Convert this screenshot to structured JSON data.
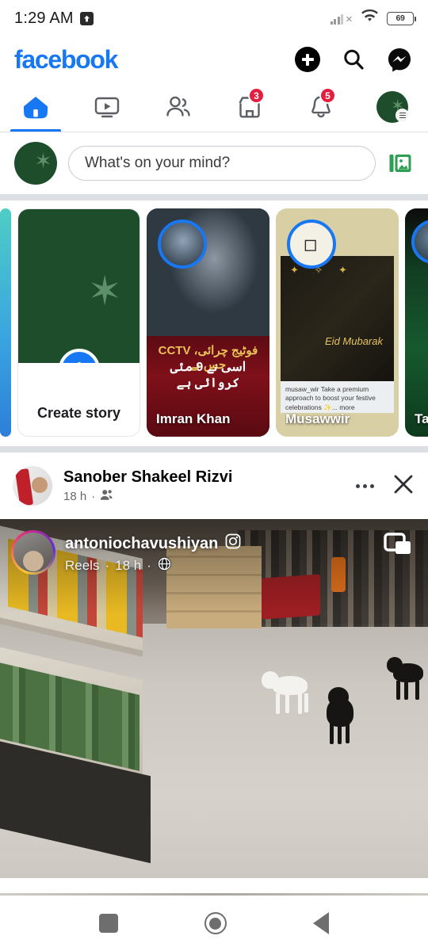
{
  "status_bar": {
    "time": "1:29 AM",
    "upload_icon": "upload-arrow-icon",
    "signal_icon": "cellular-signal-off-icon",
    "wifi_icon": "wifi-icon",
    "battery_level": "69"
  },
  "header": {
    "logo_text": "facebook",
    "logo_color": "#1877F2",
    "actions": [
      {
        "name": "create-button",
        "icon": "plus-circle-icon"
      },
      {
        "name": "search-button",
        "icon": "search-icon"
      },
      {
        "name": "messenger-button",
        "icon": "messenger-icon"
      }
    ]
  },
  "tabs": [
    {
      "name": "tab-home",
      "icon": "home-icon",
      "active": true,
      "badge": ""
    },
    {
      "name": "tab-video",
      "icon": "video-icon",
      "active": false,
      "badge": ""
    },
    {
      "name": "tab-friends",
      "icon": "friends-icon",
      "active": false,
      "badge": ""
    },
    {
      "name": "tab-marketplace",
      "icon": "marketplace-icon",
      "active": false,
      "badge": "3"
    },
    {
      "name": "tab-notifications",
      "icon": "bell-icon",
      "active": false,
      "badge": "5"
    },
    {
      "name": "tab-menu",
      "icon": "profile-menu-icon",
      "active": false,
      "badge": ""
    }
  ],
  "composer": {
    "placeholder": "What's on your mind?",
    "avatar_icon": "user-avatar",
    "photo_icon": "photo-gallery-icon",
    "photo_color": "#2e9e52"
  },
  "stories": {
    "create": {
      "label": "Create story",
      "plus_icon": "plus-icon",
      "bg_color": "#1d4d2b"
    },
    "items": [
      {
        "name": "Imran Khan",
        "caption_line1": "CCTV فوٹیج چرائی، جس نے",
        "caption_line2": "اسی نے 9 مئی کروائی ہے",
        "ring_color": "#1877F2"
      },
      {
        "name": "Musawwir",
        "caption": "musaw_wir Take a premium approach to boost your festive celebrations ✨... more",
        "card_text": "Eid Mubarak",
        "ring_color": "#1877F2"
      },
      {
        "name": "Tabis",
        "ring_color": "#1877F2"
      }
    ]
  },
  "post": {
    "author": "Sanober Shakeel Rizvi",
    "timestamp": "18 h",
    "privacy_icon": "friends-privacy-icon",
    "separator": "·",
    "menu_icon": "more-options-icon",
    "close_icon": "close-icon",
    "video": {
      "reel_username": "antoniochavushiyan",
      "instagram_icon": "instagram-icon",
      "source_label": "Reels",
      "source_time": "18 h",
      "globe_icon": "public-globe-icon",
      "separator": "·",
      "pip_icon": "picture-in-picture-icon"
    }
  },
  "android_nav": {
    "recents": "recents-square-icon",
    "home": "home-circle-icon",
    "back": "back-triangle-icon"
  }
}
